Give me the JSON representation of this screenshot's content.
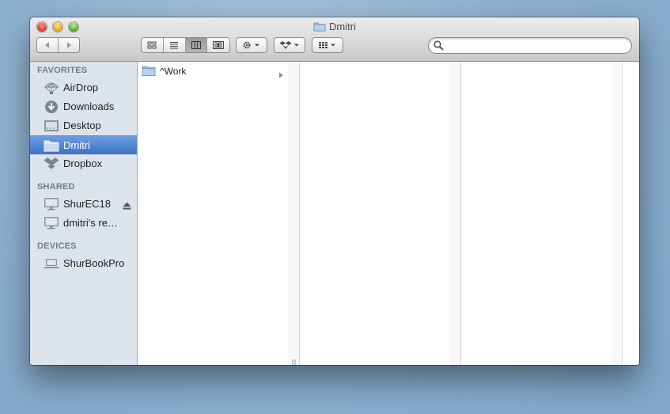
{
  "window": {
    "title": "Dmitri"
  },
  "toolbar": {
    "back_icon": "back-arrow-icon",
    "forward_icon": "forward-arrow-icon",
    "views": [
      "icon-view-icon",
      "list-view-icon",
      "column-view-icon",
      "coverflow-view-icon"
    ],
    "active_view": "column",
    "action_icon": "gear-icon",
    "dropbox_icon": "dropbox-icon",
    "arrange_icon": "arrange-icon",
    "search": {
      "placeholder": "",
      "value": ""
    }
  },
  "sidebar": {
    "sections": [
      {
        "header": "FAVORITES"
      },
      {
        "header": "SHARED"
      },
      {
        "header": "DEVICES"
      }
    ],
    "favorites": [
      {
        "label": "AirDrop",
        "icon": "airdrop-icon"
      },
      {
        "label": "Downloads",
        "icon": "downloads-icon"
      },
      {
        "label": "Desktop",
        "icon": "desktop-icon"
      },
      {
        "label": "Dmitri",
        "icon": "home-folder-icon",
        "selected": true
      },
      {
        "label": "Dropbox",
        "icon": "dropbox-icon"
      }
    ],
    "shared": [
      {
        "label": "ShurEC18",
        "icon": "monitor-icon",
        "eject": true
      },
      {
        "label": "dmitri's re…",
        "icon": "monitor-icon"
      }
    ],
    "devices": [
      {
        "label": "ShurBookPro",
        "icon": "laptop-icon"
      }
    ]
  },
  "columns": [
    {
      "items": [
        {
          "label": "^Work",
          "icon": "folder-icon",
          "has_children": true
        }
      ]
    },
    {
      "items": []
    },
    {
      "items": []
    }
  ],
  "colors": {
    "selection": "#3f72c4",
    "sidebar_bg": "#dde3ea"
  }
}
